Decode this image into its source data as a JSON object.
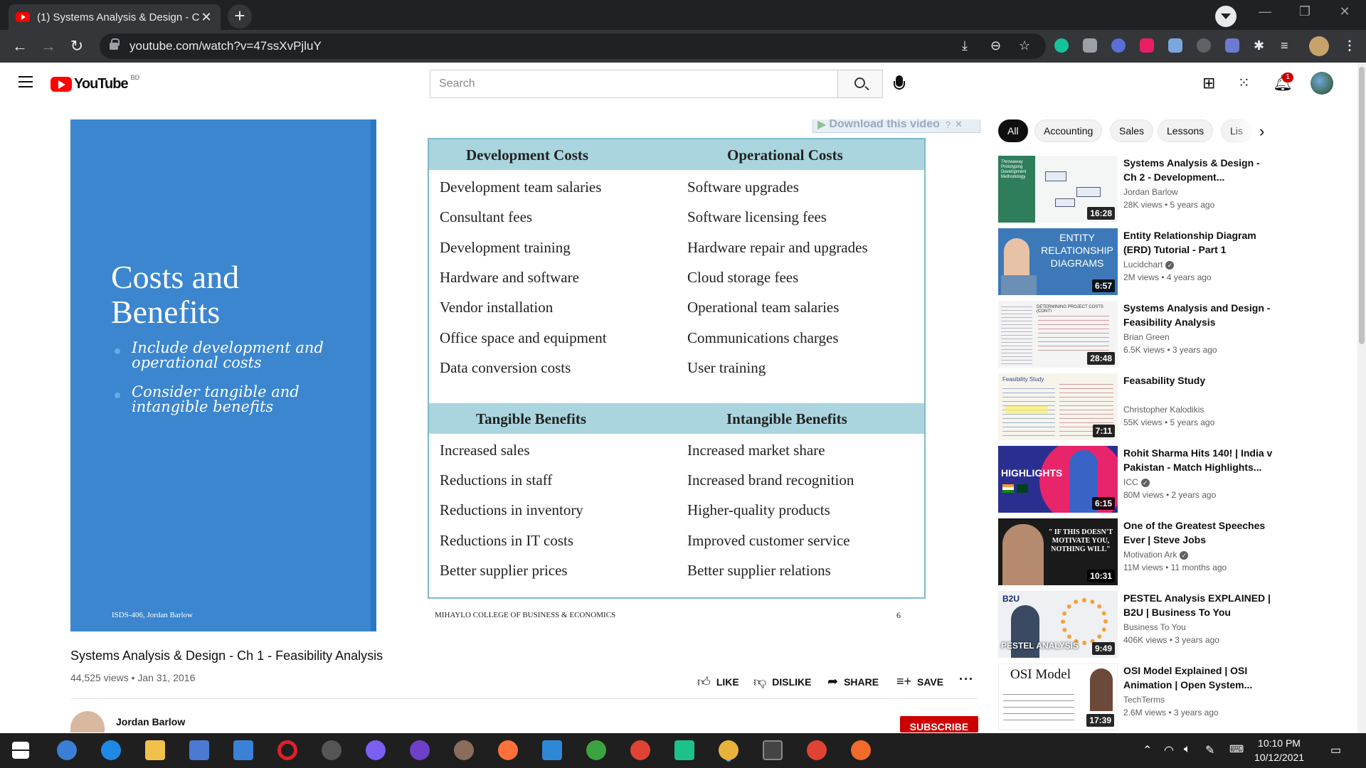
{
  "browser": {
    "tab_title": "(1) Systems Analysis & Design - C",
    "tab_close": "✕",
    "new_tab": "+",
    "url": "youtube.com/watch?v=47ssXvPjluY"
  },
  "header": {
    "logo_text": "YouTube",
    "country": "BD",
    "search_placeholder": "Search",
    "notification_count": "1"
  },
  "video": {
    "slide": {
      "title": "Costs and Benefits",
      "bullets": [
        "Include development and operational costs",
        "Consider tangible and intangible benefits"
      ],
      "course": "ISDS-406, Jordan Barlow",
      "download_label": "Download this video",
      "table": {
        "costs_headers": [
          "Development Costs",
          "Operational Costs"
        ],
        "development_costs": [
          "Development team salaries",
          "Consultant fees",
          "Development training",
          "Hardware and software",
          "Vendor installation",
          "Office space and equipment",
          "Data conversion costs"
        ],
        "operational_costs": [
          "Software upgrades",
          "Software licensing fees",
          "Hardware repair and upgrades",
          "Cloud storage fees",
          "Operational team salaries",
          "Communications charges",
          "User training"
        ],
        "benefits_headers": [
          "Tangible Benefits",
          "Intangible Benefits"
        ],
        "tangible_benefits": [
          "Increased sales",
          "Reductions in staff",
          "Reductions in inventory",
          "Reductions in IT costs",
          "Better supplier prices"
        ],
        "intangible_benefits": [
          "Increased market share",
          "Increased brand recognition",
          "Higher-quality products",
          "Improved customer service",
          "Better supplier relations"
        ]
      },
      "footer": "MIHAYLO COLLEGE OF BUSINESS & ECONOMICS",
      "page_number": "6"
    },
    "title": "Systems Analysis & Design - Ch 1 - Feasibility Analysis",
    "meta": "44,525 views • Jan 31, 2016",
    "actions": {
      "like": "LIKE",
      "dislike": "DISLIKE",
      "share": "SHARE",
      "save": "SAVE"
    },
    "channel": "Jordan Barlow",
    "subscribe": "SUBSCRIBE"
  },
  "chips": [
    "All",
    "Accounting",
    "Sales",
    "Lessons",
    "Lis"
  ],
  "recommendations": [
    {
      "title": "Systems Analysis & Design - Ch 2 - Development...",
      "channel": "Jordan Barlow",
      "verified": false,
      "meta": "28K views • 5 years ago",
      "duration": "16:28",
      "thumb_color": "#2e7d5b",
      "thumb_label": "Throwaway Prototyping Development Methodology"
    },
    {
      "title": "Entity Relationship Diagram (ERD) Tutorial - Part 1",
      "channel": "Lucidchart",
      "verified": true,
      "meta": "2M views • 4 years ago",
      "duration": "6:57",
      "thumb_color": "#3d79b8",
      "thumb_label": "ENTITY RELATIONSHIP DIAGRAMS"
    },
    {
      "title": "Systems Analysis and Design - Feasibility Analysis",
      "channel": "Brian Green",
      "verified": false,
      "meta": "6.5K views • 3 years ago",
      "duration": "28:48",
      "thumb_color": "#f4f4f4",
      "thumb_label": "DETERMINING PROJECT COSTS (CONT)"
    },
    {
      "title": "Feasability Study",
      "channel": "Christopher Kalodikis",
      "verified": false,
      "meta": "55K views • 5 years ago",
      "duration": "7:11",
      "thumb_color": "#f7f4ec",
      "thumb_label": "Feasibility Study"
    },
    {
      "title": "Rohit Sharma Hits 140! | India v Pakistan - Match Highlights...",
      "channel": "ICC",
      "verified": true,
      "meta": "80M views • 2 years ago",
      "duration": "6:15",
      "thumb_color": "#2a2f8f",
      "thumb_label": "HIGHLIGHTS"
    },
    {
      "title": "One of the Greatest Speeches Ever | Steve Jobs",
      "channel": "Motivation Ark",
      "verified": true,
      "meta": "11M views • 11 months ago",
      "duration": "10:31",
      "thumb_color": "#1a1a1a",
      "thumb_label": "\" IF THIS DOESN'T MOTIVATE YOU, NOTHING WILL\""
    },
    {
      "title": "PESTEL Analysis EXPLAINED | B2U | Business To You",
      "channel": "Business To You",
      "verified": false,
      "meta": "406K views • 3 years ago",
      "duration": "9:49",
      "thumb_color": "#eef0f3",
      "thumb_label": "PESTEL ANALYSIS"
    },
    {
      "title": "OSI Model Explained | OSI Animation | Open System...",
      "channel": "TechTerms",
      "verified": false,
      "meta": "2.6M views • 3 years ago",
      "duration": "17:39",
      "thumb_color": "#ffffff",
      "thumb_label": "OSI Model"
    }
  ],
  "taskbar": {
    "time": "10:10 PM",
    "date": "10/12/2021"
  },
  "colors": {
    "accent": "#ff0000",
    "subscribe": "#cc0000",
    "slide_blue": "#3b86cf",
    "table_header": "#aad5df"
  }
}
